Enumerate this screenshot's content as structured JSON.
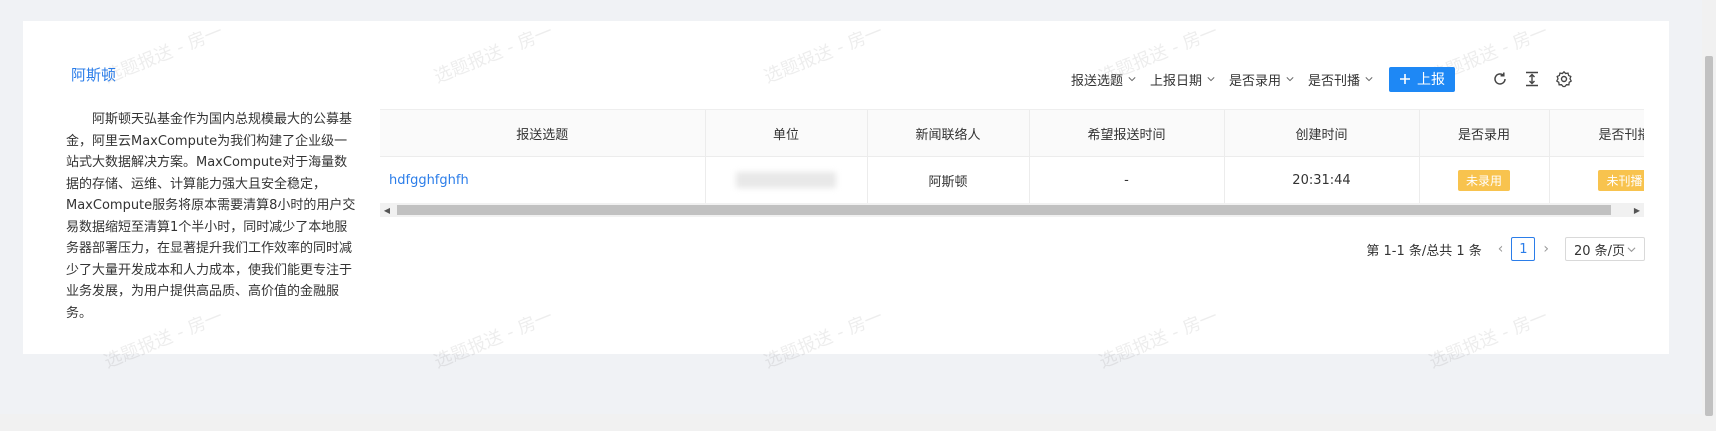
{
  "profile": {
    "title": "阿斯顿",
    "description": "阿斯顿天弘基金作为国内总规模最大的公募基金，阿里云MaxCompute为我们构建了企业级一站式大数据解决方案。MaxCompute对于海量数据的存储、运维、计算能力强大且安全稳定，MaxCompute服务将原本需要清算8小时的用户交易数据缩短至清算1个半小时，同时减少了本地服务器部署压力，在显著提升我们工作效率的同时减少了大量开发成本和人力成本，使我们能更专注于业务发展，为用户提供高品质、高价值的金融服务。"
  },
  "toolbar": {
    "filters": [
      "报送选题",
      "上报日期",
      "是否录用",
      "是否刊播"
    ],
    "report_label": "上报",
    "icons": [
      "refresh-icon",
      "column-height-icon",
      "settings-icon"
    ]
  },
  "table": {
    "headers": [
      "报送选题",
      "单位",
      "新闻联络人",
      "希望报送时间",
      "创建时间",
      "是否录用",
      "是否刊播"
    ],
    "rows": [
      {
        "topic": "hdfgghfghfh",
        "unit": "",
        "contact": "阿斯顿",
        "hope_time": "-",
        "created": "20:31:44",
        "adopted": "未录用",
        "broadcast": "未刊播"
      }
    ]
  },
  "pagination": {
    "summary": "第 1-1 条/总共 1 条",
    "current": "1",
    "page_size": "20 条/页"
  },
  "watermark": "选题报送 - 房一",
  "colors": {
    "primary": "#1e88f5",
    "link": "#2b7de9",
    "tag_warning": "#f8c34e"
  }
}
